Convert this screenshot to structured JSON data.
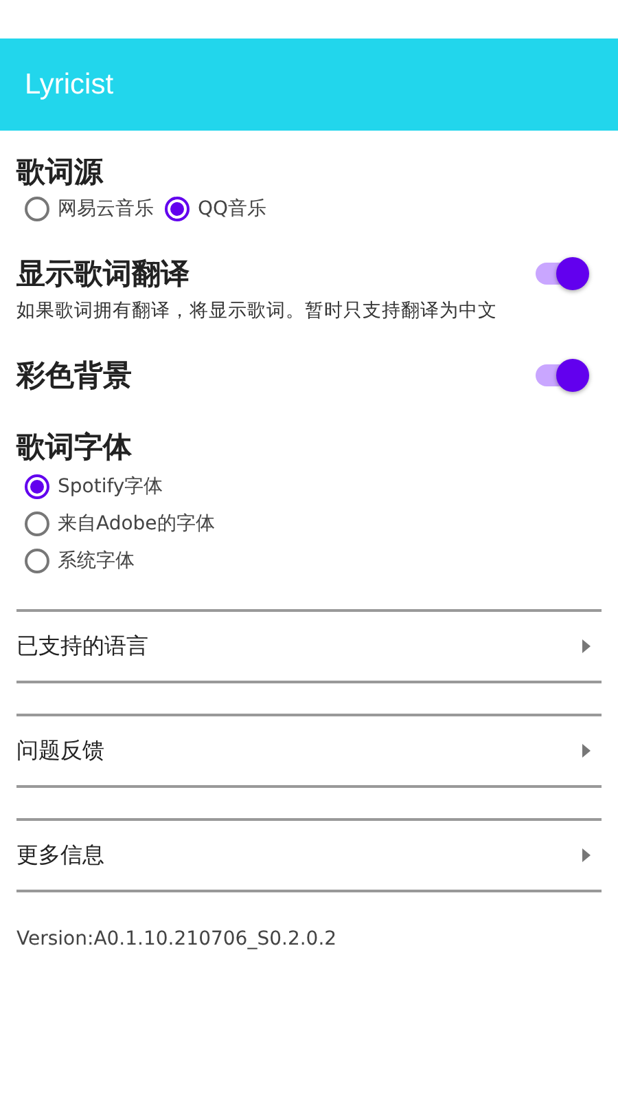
{
  "app_bar": {
    "title": "Lyricist"
  },
  "lyric_source": {
    "heading": "歌词源",
    "options": [
      {
        "label": "网易云音乐",
        "selected": false
      },
      {
        "label": "QQ音乐",
        "selected": true
      }
    ]
  },
  "switches": [
    {
      "label": "显示歌词翻译",
      "description": "如果歌词拥有翻译，将显示歌词。暂时只支持翻译为中文",
      "on": true
    },
    {
      "label": "彩色背景",
      "on": true
    }
  ],
  "lyric_font": {
    "heading": "歌词字体",
    "options": [
      {
        "label": "Spotify字体",
        "selected": true
      },
      {
        "label": "来自Adobe的字体",
        "selected": false
      },
      {
        "label": "系统字体",
        "selected": false
      }
    ]
  },
  "menu": [
    {
      "label": "已支持的语言"
    },
    {
      "label": "问题反馈"
    },
    {
      "label": "更多信息"
    }
  ],
  "version": "Version:A0.1.10.210706_S0.2.0.2"
}
